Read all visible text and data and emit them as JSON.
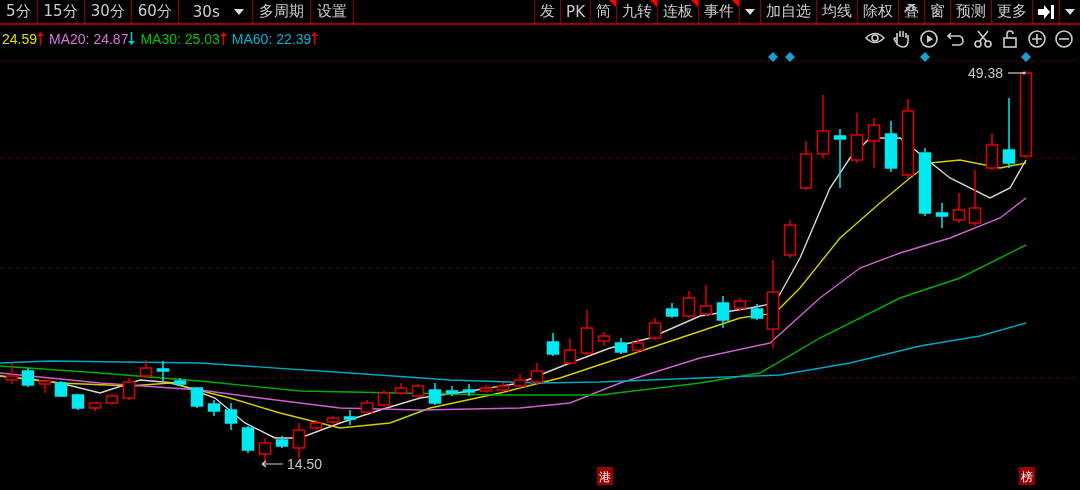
{
  "toolbar_left": [
    {
      "label": "5分",
      "kind": "button"
    },
    {
      "label": "15分",
      "kind": "button"
    },
    {
      "label": "30分",
      "kind": "button"
    },
    {
      "label": "60分",
      "kind": "button"
    },
    {
      "label": "30s",
      "kind": "dropdown"
    },
    {
      "label": "多周期",
      "kind": "button"
    },
    {
      "label": "设置",
      "kind": "button"
    }
  ],
  "toolbar_right": [
    {
      "label": "发",
      "flagged": false,
      "kind": "button"
    },
    {
      "label": "PK",
      "flagged": false,
      "kind": "button"
    },
    {
      "label": "简",
      "flagged": true,
      "kind": "button"
    },
    {
      "label": "九转",
      "flagged": true,
      "kind": "button"
    },
    {
      "label": "连板",
      "flagged": true,
      "kind": "button"
    },
    {
      "label": "事件",
      "flagged": true,
      "kind": "button"
    },
    {
      "kind": "caret"
    },
    {
      "label": "加自选",
      "flagged": false,
      "kind": "button"
    },
    {
      "label": "均线",
      "flagged": false,
      "kind": "button"
    },
    {
      "label": "除权",
      "flagged": false,
      "kind": "button"
    },
    {
      "label": "叠",
      "flagged": false,
      "kind": "button"
    },
    {
      "label": "窗",
      "flagged": false,
      "kind": "button"
    },
    {
      "label": "预测",
      "flagged": false,
      "kind": "button"
    },
    {
      "label": "更多",
      "flagged": false,
      "kind": "button"
    },
    {
      "kind": "expand"
    },
    {
      "kind": "caret"
    }
  ],
  "ma_legend": [
    {
      "text": "24.59",
      "color": "#e0e000",
      "rising": true
    },
    {
      "text": "MA20: 24.87",
      "color": "#e070e0",
      "rising": false
    },
    {
      "text": "MA30: 25.03",
      "color": "#00c800",
      "rising": true
    },
    {
      "text": "MA60: 22.39",
      "color": "#00b4d2",
      "rising": true
    }
  ],
  "chart": {
    "high_label": "49.38",
    "low_label": "14.50",
    "markers": [
      {
        "label": "港"
      },
      {
        "label": "榜"
      }
    ]
  }
}
